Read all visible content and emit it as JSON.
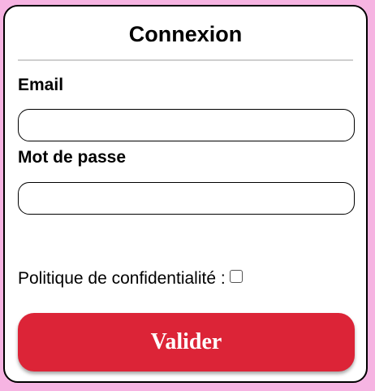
{
  "form": {
    "title": "Connexion",
    "email_label": "Email",
    "email_value": "",
    "password_label": "Mot de passe",
    "password_value": "",
    "privacy_label": "Politique de confidentialité :",
    "privacy_checked": false,
    "submit_label": "Valider"
  },
  "colors": {
    "background": "#f6b4e2",
    "card": "#ffffff",
    "submit": "#dc2437",
    "divider": "#cfcfcf"
  }
}
